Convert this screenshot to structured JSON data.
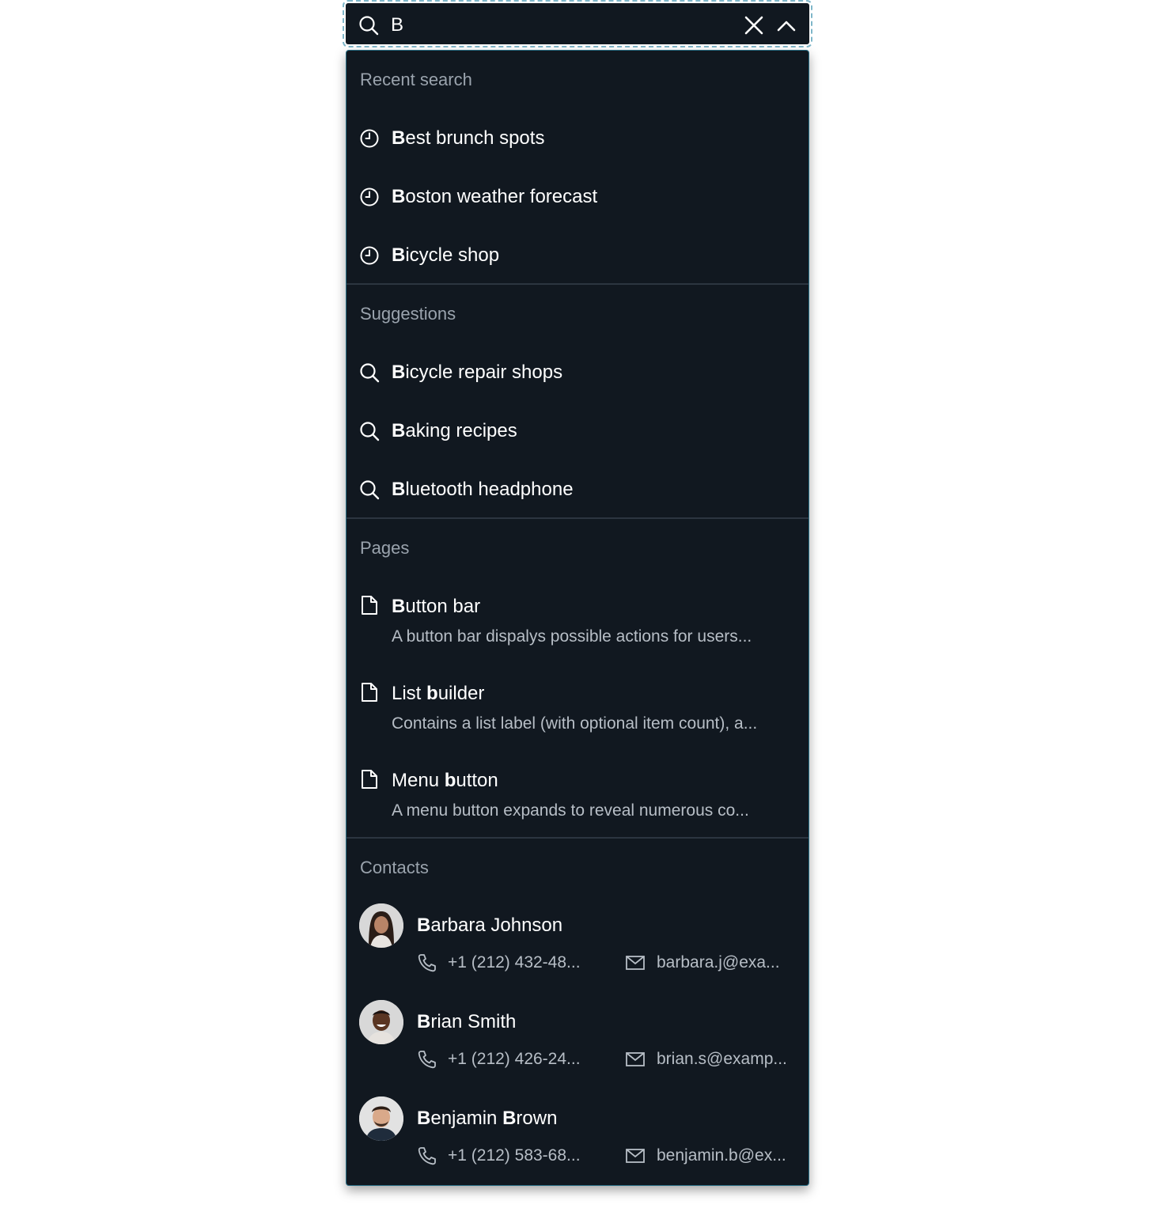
{
  "search": {
    "query": "B",
    "icon": "search-icon",
    "clear_icon": "close-icon",
    "collapse_icon": "chevron-up-icon"
  },
  "recent": {
    "title": "Recent search",
    "items": [
      {
        "bold": "B",
        "rest": "est brunch spots",
        "icon": "clock-icon"
      },
      {
        "bold": "B",
        "rest": "oston weather forecast",
        "icon": "clock-icon"
      },
      {
        "bold": "B",
        "rest": "icycle shop",
        "icon": "clock-icon"
      }
    ]
  },
  "suggestions": {
    "title": "Suggestions",
    "items": [
      {
        "bold": "B",
        "rest": "icycle repair shops",
        "icon": "search-icon"
      },
      {
        "bold": "B",
        "rest": "aking recipes",
        "icon": "search-icon"
      },
      {
        "bold": "B",
        "rest": "luetooth headphone",
        "icon": "search-icon"
      }
    ]
  },
  "pages": {
    "title": "Pages",
    "items": [
      {
        "pre": "",
        "bold": "B",
        "rest": "utton bar",
        "description": "A button bar dispalys possible actions for users...",
        "icon": "document-icon"
      },
      {
        "pre": "List ",
        "bold": "b",
        "rest": "uilder",
        "description": "Contains a list label (with optional item count), a...",
        "icon": "document-icon"
      },
      {
        "pre": "Menu ",
        "bold": "b",
        "rest": "utton",
        "description": "A menu button expands to reveal numerous co...",
        "icon": "document-icon"
      }
    ]
  },
  "contacts": {
    "title": "Contacts",
    "items": [
      {
        "name_first_bold": "B",
        "name_first_rest": "arbara Johnson",
        "name_last_bold": "",
        "name_last_rest": "",
        "phone": "+1 (212) 432-48...",
        "email": "barbara.j@exa...",
        "avatar": "avatar-barbara"
      },
      {
        "name_first_bold": "B",
        "name_first_rest": "rian Smith",
        "name_last_bold": "",
        "name_last_rest": "",
        "phone": "+1 (212) 426-24...",
        "email": "brian.s@examp...",
        "avatar": "avatar-brian"
      },
      {
        "name_first_bold": "B",
        "name_first_rest": "enjamin ",
        "name_last_bold": "B",
        "name_last_rest": "rown",
        "phone": "+1 (212) 583-68...",
        "email": "benjamin.b@ex...",
        "avatar": "avatar-benjamin"
      }
    ]
  },
  "colors": {
    "panel": "#111820",
    "focus_outline": "#7fb6c9",
    "divider": "#2c3540",
    "muted_text": "#9aa3ad"
  }
}
